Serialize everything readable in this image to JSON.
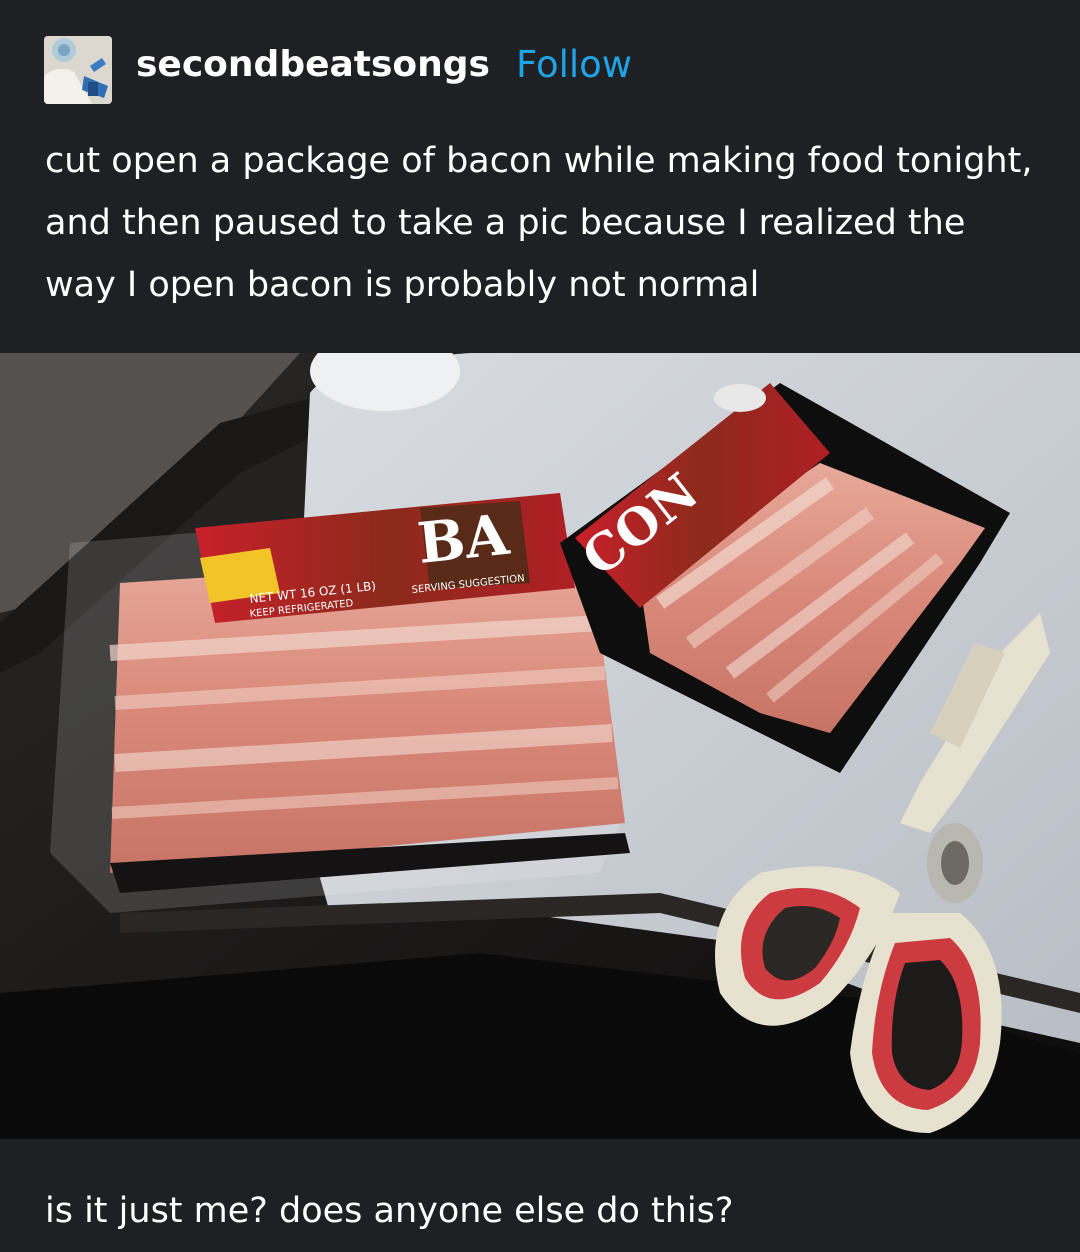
{
  "post": {
    "username": "secondbeatsongs",
    "follow_label": "Follow",
    "caption": "cut open a package of bacon while making food tonight, and then paused to take a pic because I realized the way I open bacon is probably not normal",
    "followup": "is it just me? does anyone else do this?"
  },
  "photo": {
    "package_text": {
      "brand_left": "BA",
      "brand_right": "CON",
      "net_weight": "NET WT 16 OZ (1 LB)",
      "keep": "KEEP REFRIGERATED",
      "serving": "SERVING SUGGESTION"
    }
  },
  "colors": {
    "background": "#1f2023",
    "text": "#ffffff",
    "follow": "#1ea3e6"
  }
}
